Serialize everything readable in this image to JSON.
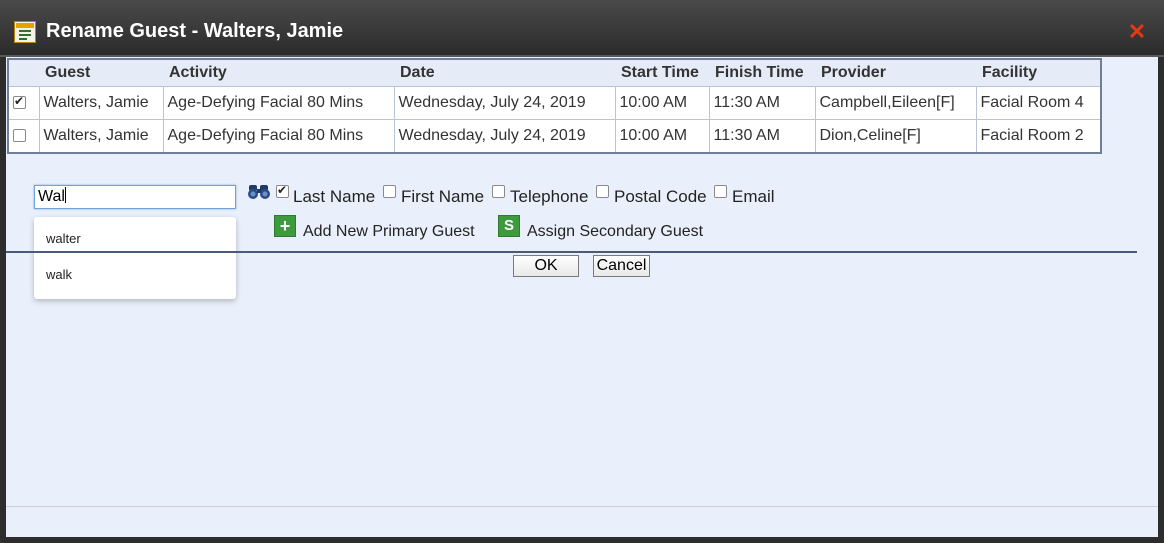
{
  "dialog": {
    "title": "Rename Guest - Walters, Jamie",
    "close_glyph": "✕"
  },
  "table": {
    "headers": [
      "Guest",
      "Activity",
      "Date",
      "Start Time",
      "Finish Time",
      "Provider",
      "Facility"
    ],
    "rows": [
      {
        "checked": true,
        "guest": "Walters, Jamie",
        "activity": "Age-Defying Facial 80 Mins",
        "date": "Wednesday, July 24, 2019",
        "start": "10:00 AM",
        "finish": "11:30 AM",
        "provider": "Campbell,Eileen[F]",
        "facility": "Facial Room 4"
      },
      {
        "checked": false,
        "guest": "Walters, Jamie",
        "activity": "Age-Defying Facial 80 Mins",
        "date": "Wednesday, July 24, 2019",
        "start": "10:00 AM",
        "finish": "11:30 AM",
        "provider": "Dion,Celine[F]",
        "facility": "Facial Room 2"
      }
    ]
  },
  "search": {
    "value": "Wal",
    "suggestions": [
      "walter",
      "walk"
    ],
    "binoculars_icon": "binoculars-icon"
  },
  "filters": {
    "last_name": {
      "label": "Last Name",
      "checked": true
    },
    "first_name": {
      "label": "First Name",
      "checked": false
    },
    "telephone": {
      "label": "Telephone",
      "checked": false
    },
    "postal_code": {
      "label": "Postal Code",
      "checked": false
    },
    "email": {
      "label": "Email",
      "checked": false
    }
  },
  "actions": {
    "add_primary": "Add New Primary Guest",
    "assign_secondary": "Assign Secondary Guest"
  },
  "buttons": {
    "ok": "OK",
    "cancel": "Cancel"
  },
  "colors": {
    "titlebar": "#2b2b2b",
    "body_bg": "#eaf0fb",
    "close_red": "#e23b14",
    "accent_green": "#3d9a3d"
  }
}
